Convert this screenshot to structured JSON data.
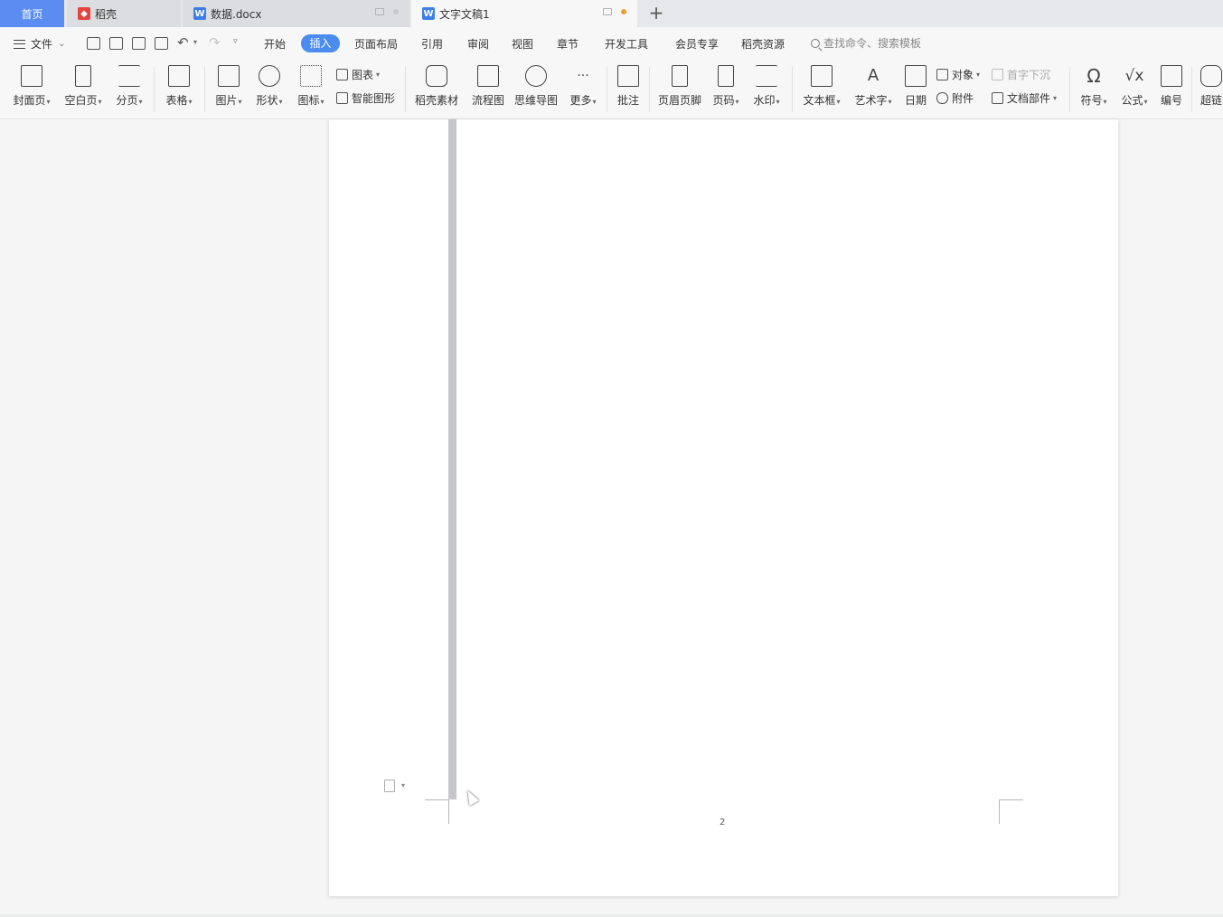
{
  "tabs": [
    {
      "label": "首页"
    },
    {
      "label": "稻壳"
    },
    {
      "label": "数据.docx"
    },
    {
      "label": "文字文稿1"
    }
  ],
  "tab_add": "+",
  "menu": {
    "file": "文件",
    "caret": "⌄",
    "items": [
      "开始",
      "插入",
      "页面布局",
      "引用",
      "审阅",
      "视图",
      "章节",
      "开发工具",
      "会员专享",
      "稻壳资源"
    ],
    "active": "插入",
    "search_placeholder": "查找命令、搜索模板"
  },
  "ribbon": {
    "cover": "封面页",
    "blank": "空白页",
    "pagebreak": "分页",
    "table": "表格",
    "picture": "图片",
    "shape": "形状",
    "icon": "图标",
    "chart": "图表",
    "smartart": "智能图形",
    "daoke_material": "稻壳素材",
    "flowchart": "流程图",
    "mindmap": "思维导图",
    "more": "更多",
    "comment": "批注",
    "header_footer": "页眉页脚",
    "page_number": "页码",
    "watermark": "水印",
    "textbox": "文本框",
    "wordart": "艺术字",
    "date": "日期",
    "object": "对象",
    "attachment": "附件",
    "dropcap": "首字下沉",
    "doc_parts": "文档部件",
    "symbol": "符号",
    "formula": "公式",
    "numbering": "编号",
    "hyperlink": "超链"
  },
  "document": {
    "page_number": "2"
  },
  "colors": {
    "home_tab": "#5b8cf2",
    "active_pill": "#4a8cf0",
    "unsaved_dot": "#f39c2c"
  }
}
